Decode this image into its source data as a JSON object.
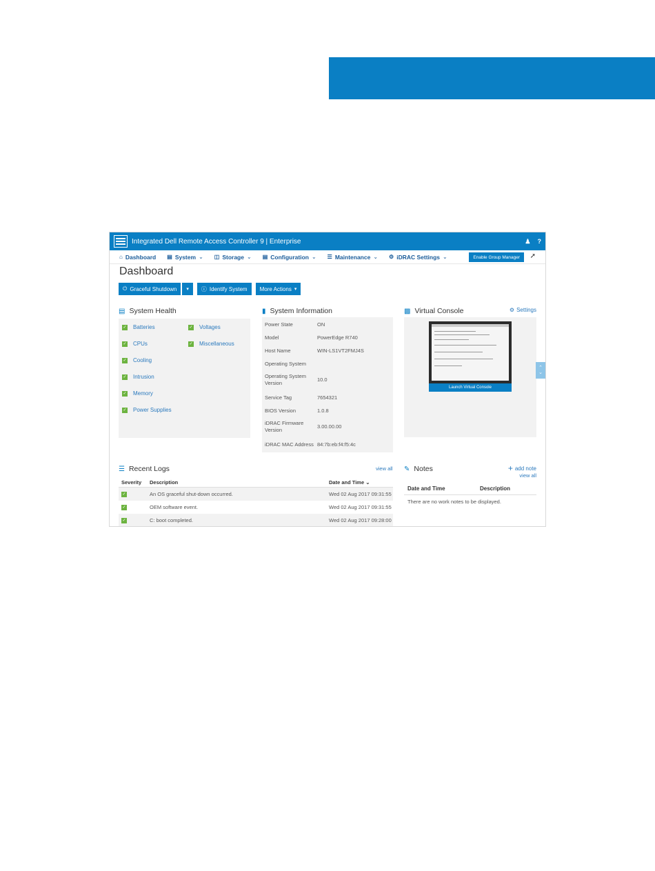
{
  "app": {
    "title": "Integrated Dell Remote Access Controller 9",
    "edition": "Enterprise",
    "user_icon": "user-icon",
    "help_icon": "help-icon"
  },
  "nav": {
    "items": [
      {
        "label": "Dashboard",
        "icon": "home-icon"
      },
      {
        "label": "System",
        "icon": "server-icon"
      },
      {
        "label": "Storage",
        "icon": "database-icon"
      },
      {
        "label": "Configuration",
        "icon": "config-icon"
      },
      {
        "label": "Maintenance",
        "icon": "maintenance-icon"
      },
      {
        "label": "iDRAC Settings",
        "icon": "settings-icon"
      }
    ],
    "enable_group_manager": "Enable Group Manager"
  },
  "page": {
    "title": "Dashboard"
  },
  "actions": {
    "graceful_shutdown": "Graceful Shutdown",
    "identify_system": "Identify System",
    "more_actions": "More Actions"
  },
  "system_health": {
    "title": "System Health",
    "items": [
      "Batteries",
      "Voltages",
      "CPUs",
      "Miscellaneous",
      "Cooling",
      "Intrusion",
      "Memory",
      "Power Supplies"
    ]
  },
  "system_information": {
    "title": "System Information",
    "rows": [
      {
        "key": "Power State",
        "value": "ON"
      },
      {
        "key": "Model",
        "value": "PowerEdge R740"
      },
      {
        "key": "Host Name",
        "value": "WIN-LS1VT2FMJ4S"
      },
      {
        "key": "Operating System",
        "value": ""
      },
      {
        "key": "Operating System Version",
        "value": "10.0"
      },
      {
        "key": "Service Tag",
        "value": "7654321"
      },
      {
        "key": "BIOS Version",
        "value": "1.0.8"
      },
      {
        "key": "iDRAC Firmware Version",
        "value": "3.00.00.00"
      },
      {
        "key": "iDRAC MAC Address",
        "value": "84:7b:eb:f4:f5:4c"
      }
    ]
  },
  "virtual_console": {
    "title": "Virtual Console",
    "settings": "Settings",
    "launch": "Launch Virtual Console"
  },
  "recent_logs": {
    "title": "Recent Logs",
    "view_all": "view all",
    "columns": [
      "Severity",
      "Description",
      "Date and Time"
    ],
    "rows": [
      {
        "description": "An OS graceful shut-down occurred.",
        "datetime": "Wed 02 Aug 2017 09:31:55"
      },
      {
        "description": "OEM software event.",
        "datetime": "Wed 02 Aug 2017 09:31:55"
      },
      {
        "description": "C: boot completed.",
        "datetime": "Wed 02 Aug 2017 09:28:00"
      }
    ]
  },
  "notes": {
    "title": "Notes",
    "add_note": "add note",
    "view_all": "view all",
    "columns": [
      "Date and Time",
      "Description"
    ],
    "empty": "There are no work notes to be displayed."
  },
  "colors": {
    "brand": "#0a7fc4",
    "ok": "#6cb33f",
    "link": "#2a79bd"
  }
}
